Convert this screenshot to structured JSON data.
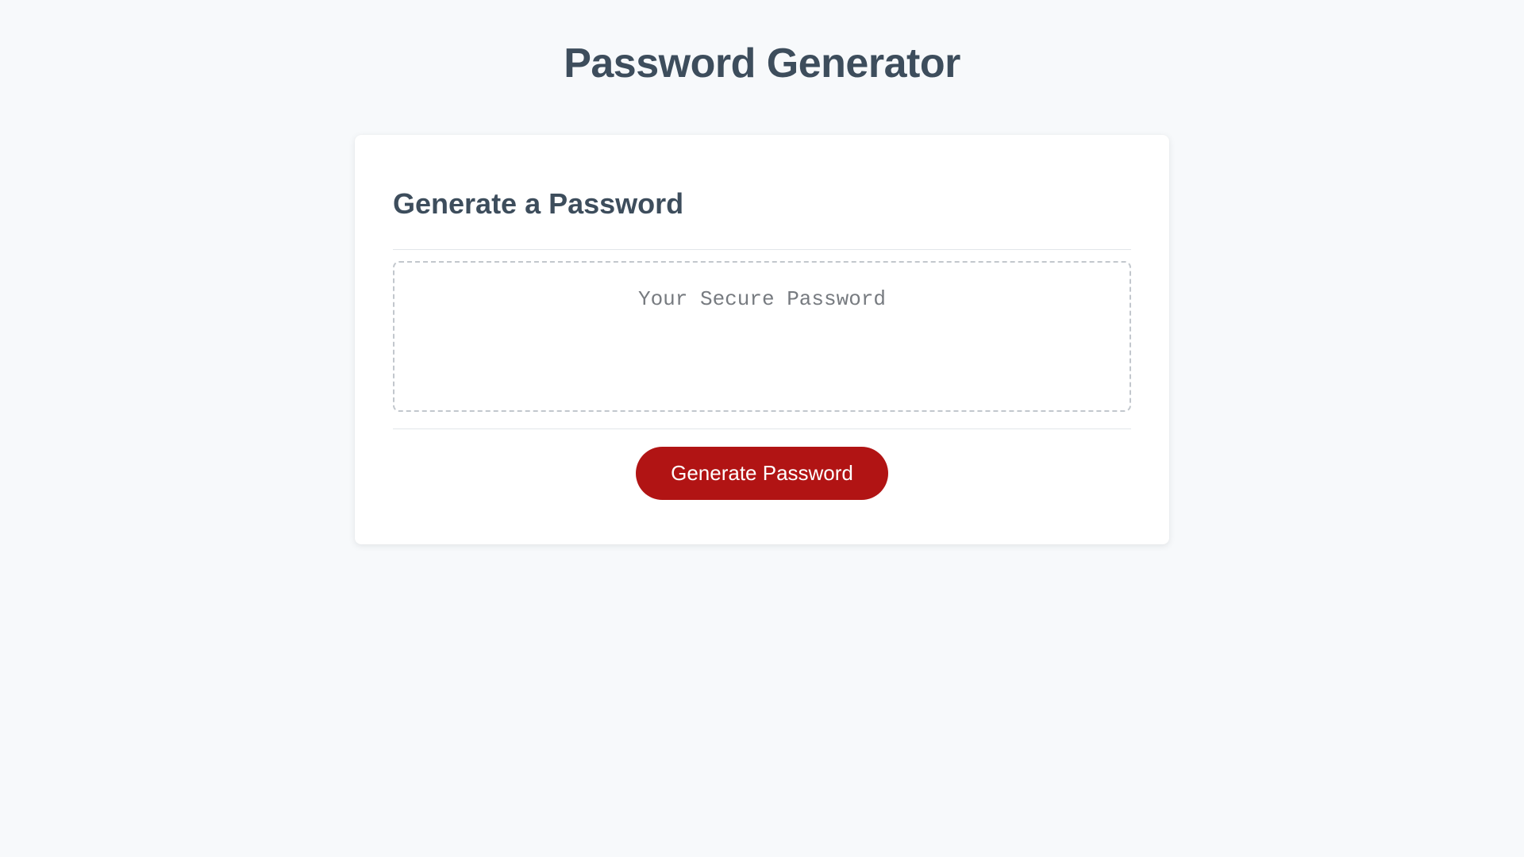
{
  "header": {
    "title": "Password Generator"
  },
  "card": {
    "heading": "Generate a Password",
    "output": {
      "placeholder": "Your Secure Password",
      "value": ""
    },
    "button_label": "Generate Password"
  },
  "colors": {
    "accent": "#b11414",
    "text_heading": "#3d4d5c",
    "page_bg": "#f7f9fb",
    "card_bg": "#ffffff",
    "dashed_border": "#c2c7cd"
  }
}
